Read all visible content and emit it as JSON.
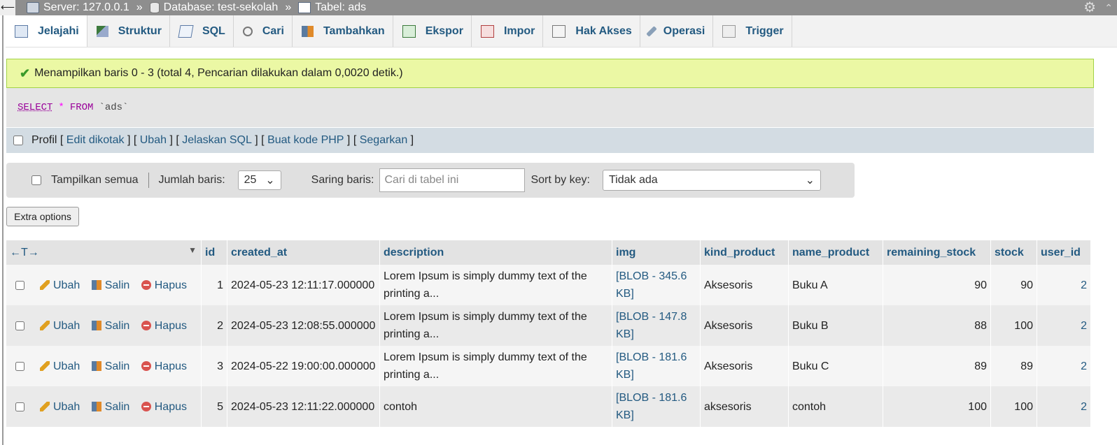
{
  "breadcrumb": {
    "server": "Server: 127.0.0.1",
    "database": "Database: test-sekolah",
    "table": "Tabel: ads",
    "separator": "»"
  },
  "tabs": [
    "Jelajahi",
    "Struktur",
    "SQL",
    "Cari",
    "Tambahkan",
    "Ekspor",
    "Impor",
    "Hak Akses",
    "Operasi",
    "Trigger"
  ],
  "success_message": "Menampilkan baris 0 - 3 (total 4, Pencarian dilakukan dalam 0,0020 detik.)",
  "sql": {
    "select": "SELECT",
    "star": "*",
    "from": "FROM",
    "table": "`ads`"
  },
  "profil": {
    "label": "Profil",
    "links": [
      "Edit dikotak",
      "Ubah",
      "Jelaskan SQL",
      "Buat kode PHP",
      "Segarkan"
    ]
  },
  "nav": {
    "show_all": "Tampilkan semua",
    "rows_label": "Jumlah baris:",
    "rows_value": "25",
    "filter_label": "Saring baris:",
    "filter_placeholder": "Cari di tabel ini",
    "sort_label": "Sort by key:",
    "sort_value": "Tidak ada"
  },
  "extra_options": "Extra options",
  "table": {
    "arrows": "←T→",
    "columns": [
      "id",
      "created_at",
      "description",
      "img",
      "kind_product",
      "name_product",
      "remaining_stock",
      "stock",
      "user_id"
    ],
    "actions": {
      "edit": "Ubah",
      "copy": "Salin",
      "delete": "Hapus"
    },
    "rows": [
      {
        "id": "1",
        "created_at": "2024-05-23 12:11:17.000000",
        "description_1": "Lorem Ipsum is simply dummy text of the",
        "description_2": "printing a...",
        "img_1": "[BLOB - 345.6",
        "img_2": "KB]",
        "kind_product": "Aksesoris",
        "name_product": "Buku A",
        "remaining_stock": "90",
        "stock": "90",
        "user_id": "2"
      },
      {
        "id": "2",
        "created_at": "2024-05-23 12:08:55.000000",
        "description_1": "Lorem Ipsum is simply dummy text of the",
        "description_2": "printing a...",
        "img_1": "[BLOB - 147.8",
        "img_2": "KB]",
        "kind_product": "Aksesoris",
        "name_product": "Buku B",
        "remaining_stock": "88",
        "stock": "100",
        "user_id": "2"
      },
      {
        "id": "3",
        "created_at": "2024-05-22 19:00:00.000000",
        "description_1": "Lorem Ipsum is simply dummy text of the",
        "description_2": "printing a...",
        "img_1": "[BLOB - 181.6",
        "img_2": "KB]",
        "kind_product": "Aksesoris",
        "name_product": "Buku C",
        "remaining_stock": "89",
        "stock": "89",
        "user_id": "2"
      },
      {
        "id": "5",
        "created_at": "2024-05-23 12:11:22.000000",
        "description_1": "contoh",
        "description_2": "",
        "img_1": "[BLOB - 181.6",
        "img_2": "KB]",
        "kind_product": "aksesoris",
        "name_product": "contoh",
        "remaining_stock": "100",
        "stock": "100",
        "user_id": "2"
      }
    ]
  }
}
